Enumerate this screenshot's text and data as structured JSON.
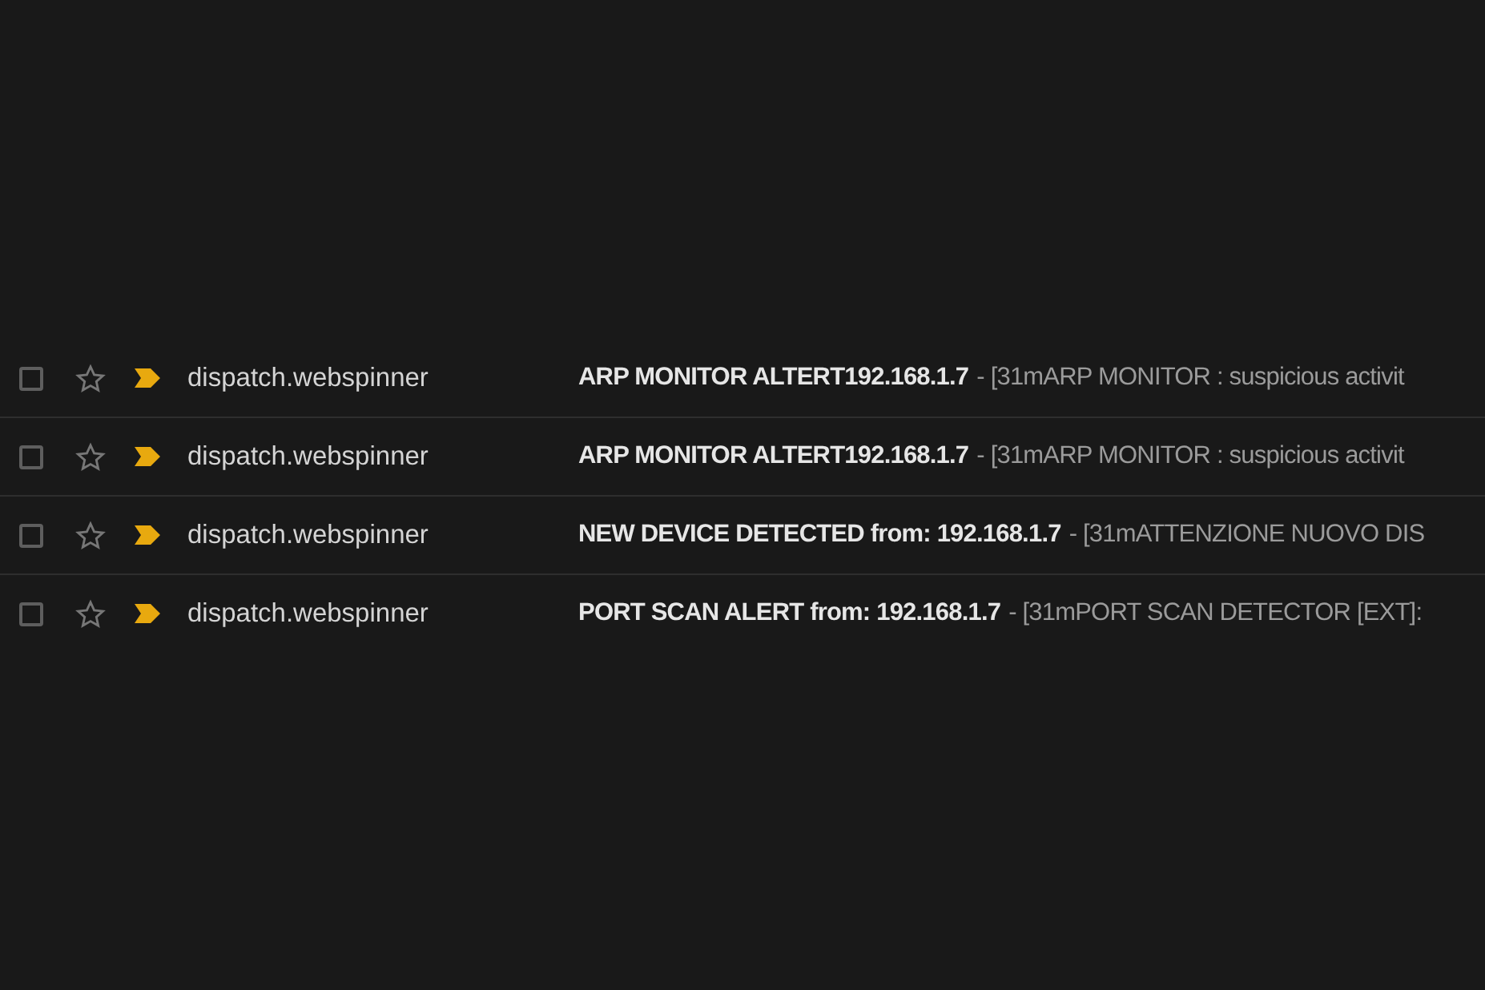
{
  "messages": [
    {
      "checked": false,
      "starred": false,
      "important": true,
      "sender": "dispatch.webspinner",
      "subject": "ARP MONITOR ALTERT192.168.1.7",
      "snippet": "- [31mARP MONITOR : suspicious activit"
    },
    {
      "checked": false,
      "starred": false,
      "important": true,
      "sender": "dispatch.webspinner",
      "subject": "ARP MONITOR ALTERT192.168.1.7",
      "snippet": "- [31mARP MONITOR : suspicious activit"
    },
    {
      "checked": false,
      "starred": false,
      "important": true,
      "sender": "dispatch.webspinner",
      "subject": "NEW DEVICE DETECTED from: 192.168.1.7",
      "snippet": "- [31mATTENZIONE NUOVO DIS"
    },
    {
      "checked": false,
      "starred": false,
      "important": true,
      "sender": "dispatch.webspinner",
      "subject": "PORT SCAN ALERT from: 192.168.1.7",
      "snippet": "- [31mPORT SCAN DETECTOR [EXT]:"
    }
  ]
}
